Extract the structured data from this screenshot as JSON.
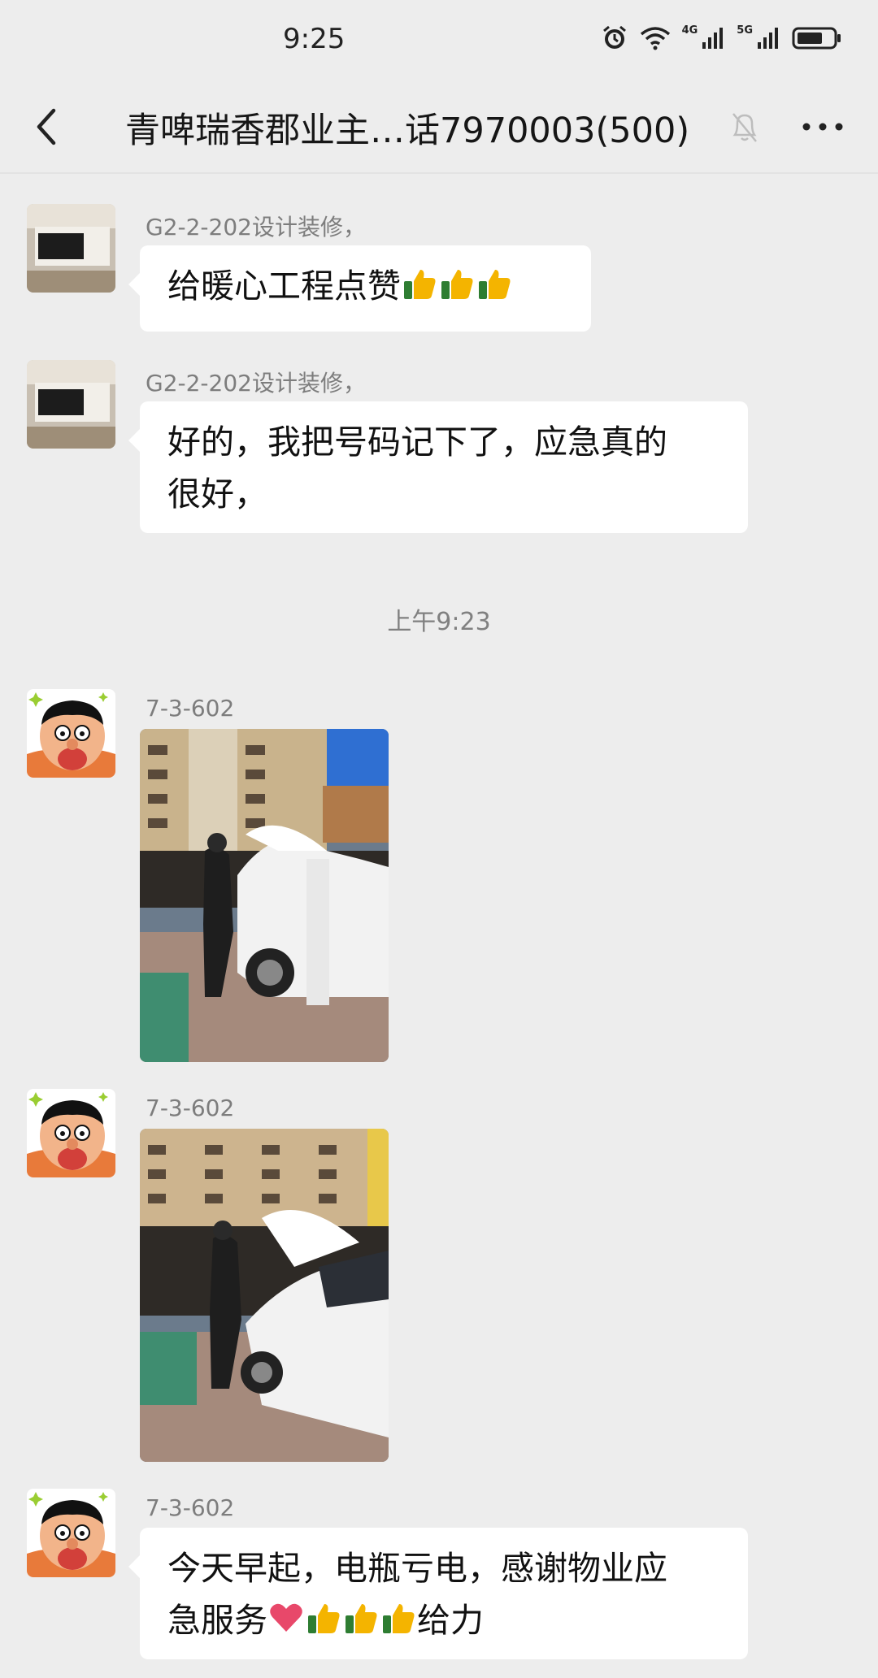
{
  "status_bar": {
    "time": "9:25",
    "network_1": "4G",
    "network_2": "5G",
    "icons": [
      "alarm-icon",
      "wifi-icon",
      "signal-icon",
      "signal-icon",
      "battery-icon"
    ]
  },
  "header": {
    "title": "青啤瑞香郡业主…话7970003(500)",
    "icons": [
      "back-icon",
      "mute-icon",
      "more-icon"
    ]
  },
  "messages": [
    {
      "sender": "G2-2-202设计装修，",
      "text": "给暖心工程点赞",
      "emoji": "thumbs-up x3"
    },
    {
      "sender": "G2-2-202设计装修，",
      "line1": "好的，我把号码记下了，应急真的",
      "line2": "很好，"
    },
    {
      "sender": "7-3-602",
      "type": "image",
      "image": "photo-car-hood-open"
    },
    {
      "sender": "7-3-602",
      "type": "image",
      "image": "photo-car-hood-open-2"
    },
    {
      "sender": "7-3-602",
      "line1": "今天早起，电瓶亏电，感谢物业应",
      "line2_a": "急服务",
      "line2_b": "给力",
      "emoji": "heart + thumbs-up x3"
    }
  ],
  "timestamp": "上午9:23"
}
